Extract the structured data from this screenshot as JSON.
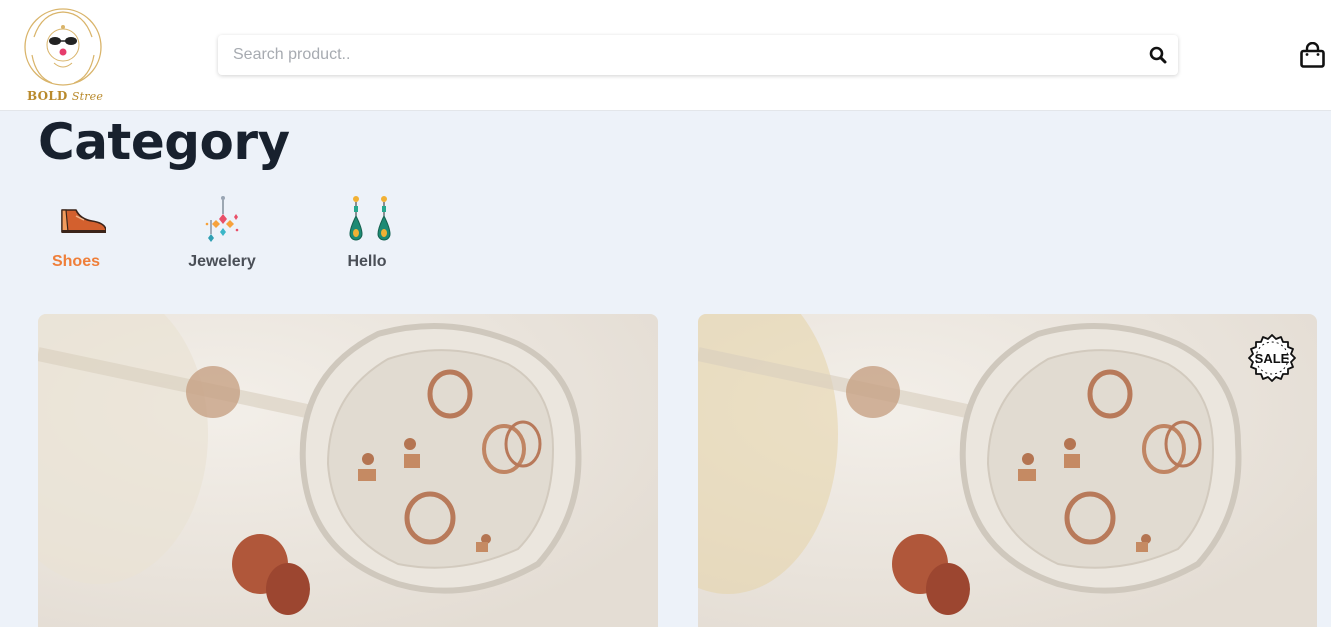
{
  "brand": {
    "name_bold": "BOLD",
    "name_script": "Stree"
  },
  "search": {
    "placeholder": "Search product..",
    "value": ""
  },
  "page_title": "Category",
  "categories": [
    {
      "label": "Shoes",
      "icon": "shoe-icon",
      "active": true
    },
    {
      "label": "Jewelery",
      "icon": "jewelry-icon",
      "active": false
    },
    {
      "label": "Hello",
      "icon": "earrings-icon",
      "active": false
    }
  ],
  "products": [
    {
      "image": "jewelry-plate-photo",
      "badge": null
    },
    {
      "image": "jewelry-plate-photo",
      "badge": "SALE"
    }
  ],
  "colors": {
    "accent": "#ef7f3a",
    "title": "#18212e",
    "background": "#edf2f9",
    "category_text": "#4a4f57"
  }
}
